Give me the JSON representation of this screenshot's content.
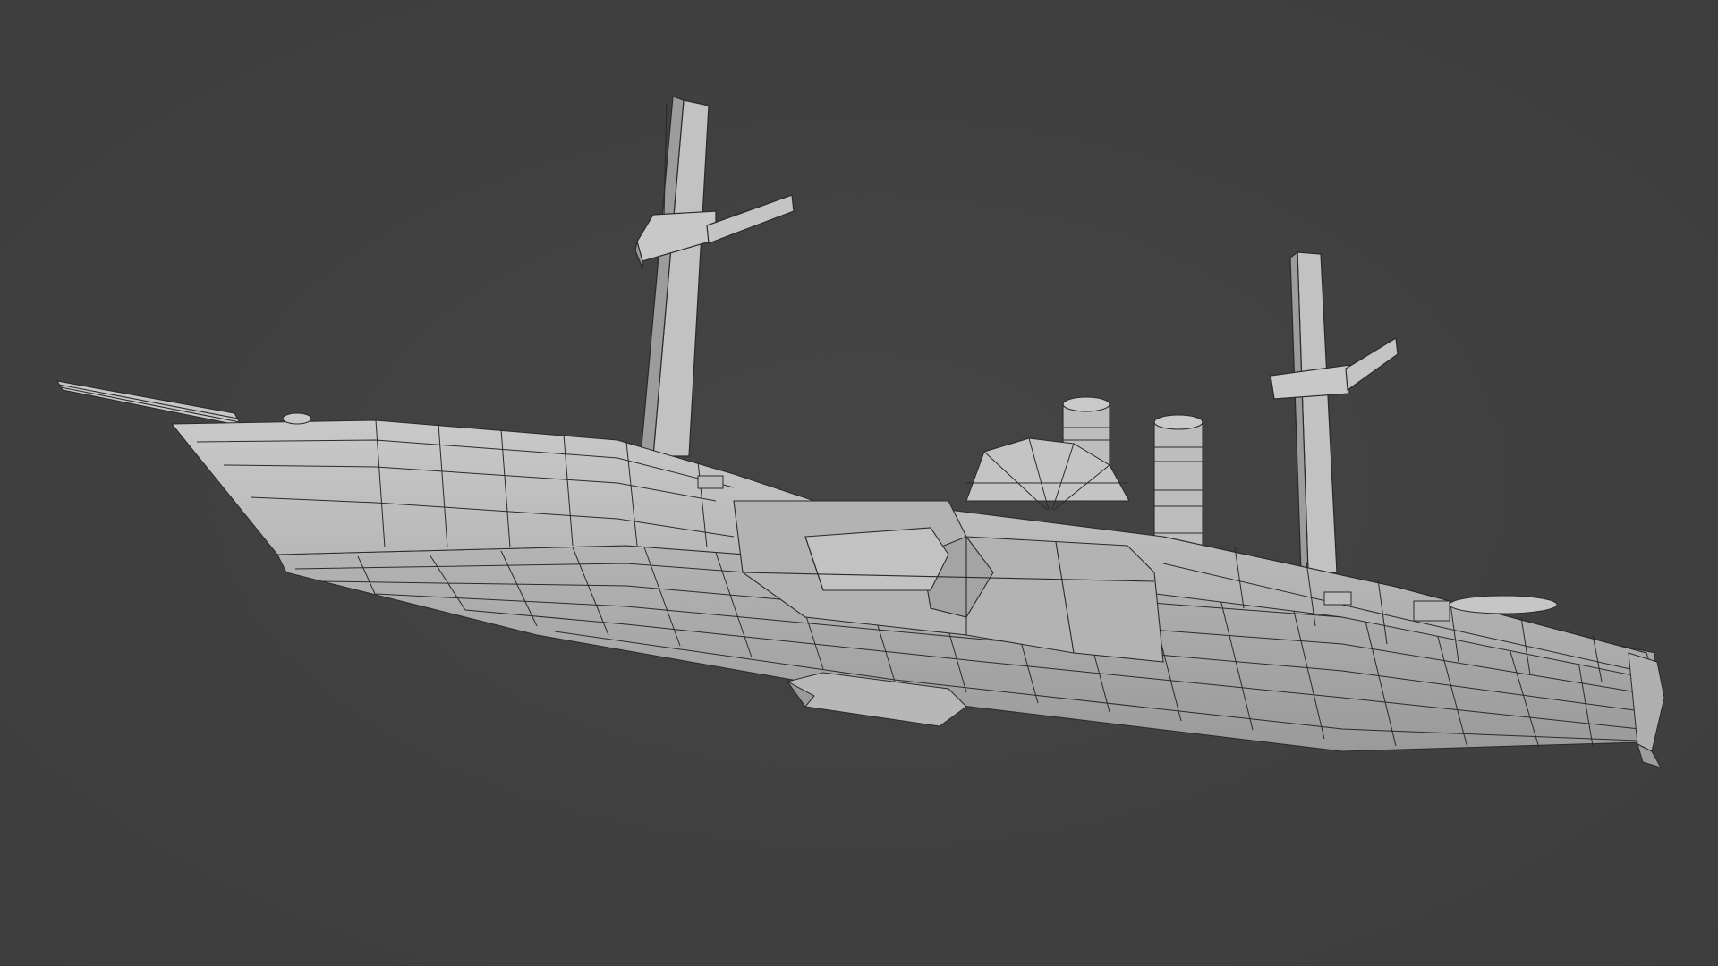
{
  "viewport": {
    "background": "#404040",
    "object": "ship-wireframe-model",
    "shading": "solid",
    "overlay": "wireframe",
    "colors": {
      "surface": "#b9b9b9",
      "surface_light": "#c8c8c8",
      "surface_dark": "#8f8f8f",
      "wire": "#2a2a2a"
    }
  }
}
